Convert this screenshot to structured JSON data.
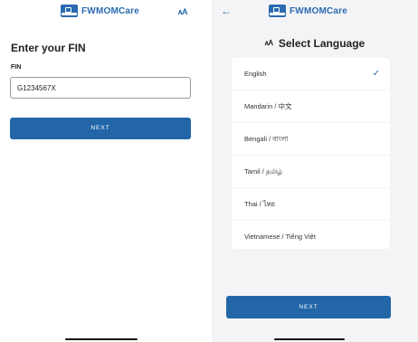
{
  "app": {
    "name": "FWMOMCare",
    "brand_color": "#2a6bb0",
    "button_color": "#2366a8"
  },
  "left_screen": {
    "header": {
      "logo_text": "FWMOMCare",
      "translate_icon": "translate-icon",
      "translate_glyph": "🗚"
    },
    "title": "Enter your FIN",
    "fin_label": "FIN",
    "fin_value": "G1234567X",
    "next_label": "NEXT"
  },
  "right_screen": {
    "header": {
      "back_icon": "arrow-left-icon",
      "back_glyph": "←",
      "logo_text": "FWMOMCare"
    },
    "title": "Select Language",
    "title_icon_glyph": "🗚",
    "languages": [
      {
        "label": "English",
        "selected": true
      },
      {
        "label": "Mandarin / 中文",
        "selected": false
      },
      {
        "label": "Bengali / বাংলা",
        "selected": false
      },
      {
        "label": "Tamil / தமிழ்",
        "selected": false
      },
      {
        "label": "Thai / ไทย",
        "selected": false
      },
      {
        "label": "Vietnamese / Tiếng Việt",
        "selected": false
      }
    ],
    "check_glyph": "✓",
    "next_label": "NEXT"
  }
}
